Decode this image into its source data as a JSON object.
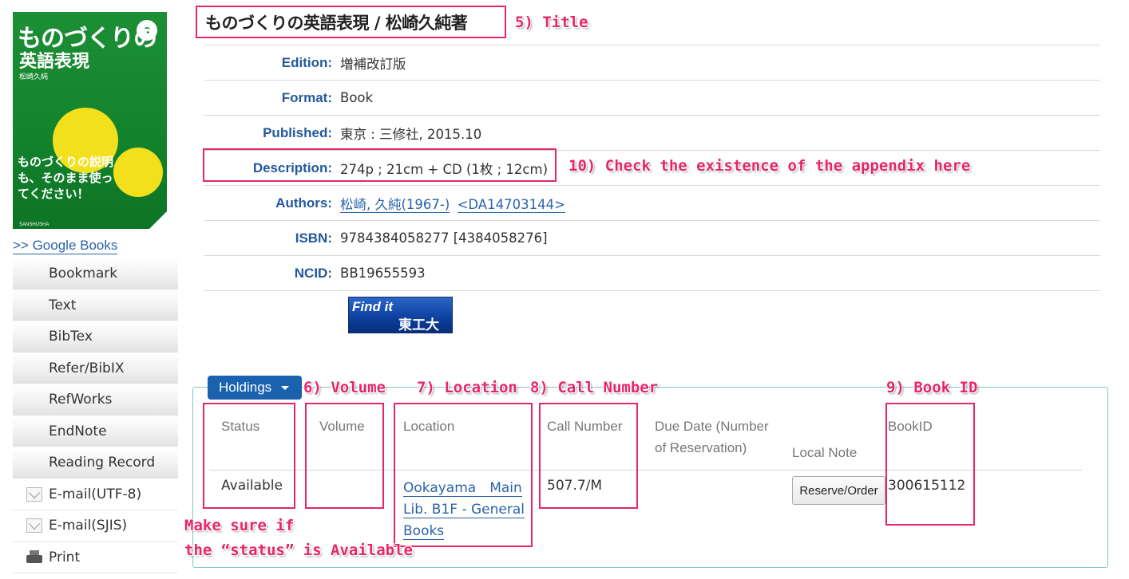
{
  "cover": {
    "title_line1": "ものづくりの",
    "title_line2": "英語表現",
    "author": "松崎久純",
    "catch": "ものづくりの説明も、そのまま使ってください！",
    "publisher": "SANSHUSHA"
  },
  "google_books_link": ">> Google Books",
  "side_menu": [
    {
      "label": "Bookmark",
      "icon": ""
    },
    {
      "label": "Text",
      "icon": ""
    },
    {
      "label": "BibTex",
      "icon": ""
    },
    {
      "label": "Refer/BibIX",
      "icon": ""
    },
    {
      "label": "RefWorks",
      "icon": ""
    },
    {
      "label": "EndNote",
      "icon": ""
    },
    {
      "label": "Reading Record",
      "icon": ""
    },
    {
      "label": "E-mail(UTF-8)",
      "icon": "mail-icon"
    },
    {
      "label": "E-mail(SJIS)",
      "icon": "mail-icon"
    },
    {
      "label": "Print",
      "icon": "printer-icon"
    }
  ],
  "title": "ものづくりの英語表現 / 松崎久純著",
  "details": {
    "edition_label": "Edition:",
    "edition_value": "増補改訂版",
    "format_label": "Format:",
    "format_value": "Book",
    "published_label": "Published:",
    "published_value": "東京 : 三修社, 2015.10",
    "description_label": "Description:",
    "description_value": "274p ; 21cm + CD (1枚 ; 12cm)",
    "authors_label": "Authors:",
    "author_link": "松崎, 久純(1967-)",
    "author_id_link": "<DA14703144>",
    "isbn_label": "ISBN:",
    "isbn_value": "9784384058277 [4384058276]",
    "ncid_label": "NCID:",
    "ncid_value": "BB19655593"
  },
  "findit": {
    "text1": "Find it",
    "text2": "東工大"
  },
  "holdings": {
    "tab_label": "Holdings",
    "headers": {
      "status": "Status",
      "volume": "Volume",
      "location": "Location",
      "call_number": "Call Number",
      "due_date_1": "Due Date (Number",
      "due_date_2": "of Reservation)",
      "local_note": "Local Note",
      "book_id": "BookID"
    },
    "row": {
      "status": "Available",
      "volume": "",
      "location_1": "Ookayama　Main",
      "location_2": "Lib. B1F - General",
      "location_3": "Books",
      "call_number": "507.7/M",
      "book_id": "300615112",
      "action": "Reserve/Order"
    }
  },
  "annotations": {
    "title": "5) Title",
    "volume": "6) Volume",
    "location": "7) Location",
    "call_number": "8) Call Number",
    "book_id": "9) Book ID",
    "description": "10) Check the existence of the appendix here",
    "status_line1": "Make sure if",
    "status_line2": "the “status” is Available"
  },
  "colors": {
    "annotation": "#e5266a",
    "label_blue": "#23599c",
    "link_blue": "#2a63a8",
    "tab_blue": "#1a62ae",
    "panel_border": "#7fc6c1"
  }
}
